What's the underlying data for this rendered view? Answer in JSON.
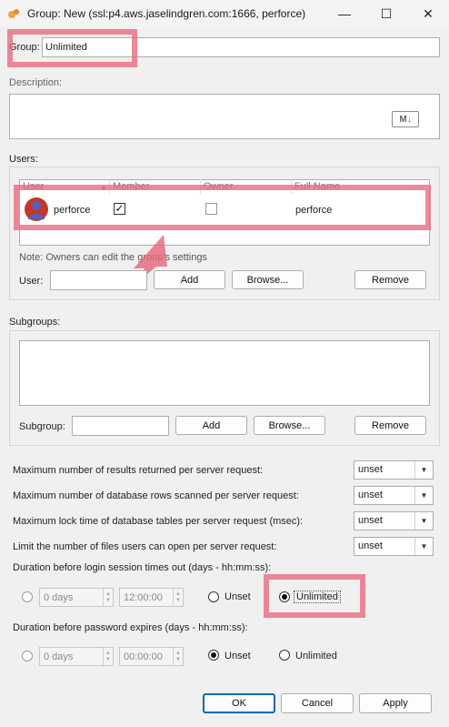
{
  "window": {
    "title": "Group: New (ssl:p4.aws.jaselindgren.com:1666,  perforce)",
    "minimize": "—",
    "maximize": "☐",
    "close": "✕"
  },
  "group": {
    "label": "Group:",
    "value": "Unlimited"
  },
  "description": {
    "label": "Description:",
    "badge": "M↓"
  },
  "users": {
    "label": "Users:",
    "columns": [
      "User",
      "Member",
      "Owner",
      "Full Name"
    ],
    "sort_indicator": "▲",
    "rows": [
      {
        "user": "perforce",
        "member": "✓",
        "owner": "",
        "full_name": "perforce"
      }
    ],
    "note": "Note: Owners can edit the group's settings",
    "user_label": "User:",
    "user_value": "",
    "add": "Add",
    "browse": "Browse...",
    "remove": "Remove"
  },
  "subgroups": {
    "label": "Subgroups:",
    "subgroup_label": "Subgroup:",
    "subgroup_value": "",
    "add": "Add",
    "browse": "Browse...",
    "remove": "Remove"
  },
  "limits": [
    {
      "label": "Maximum number of results returned per server request:",
      "value": "unset"
    },
    {
      "label": "Maximum number of database rows scanned per server request:",
      "value": "unset"
    },
    {
      "label": "Maximum lock time of database tables per server request (msec):",
      "value": "unset"
    },
    {
      "label": "Limit the number of files users can open per server request:",
      "value": "unset"
    }
  ],
  "session": {
    "label": "Duration before login session times out (days - hh:mm:ss):",
    "days": "0 days",
    "time": "12:00:00",
    "unset": "Unset",
    "unlimited": "Unlimited",
    "selected": "unlimited"
  },
  "password": {
    "label": "Duration before password expires (days - hh:mm:ss):",
    "days": "0 days",
    "time": "00:00:00",
    "unset": "Unset",
    "unlimited": "Unlimited",
    "selected": "unset"
  },
  "footer": {
    "ok": "OK",
    "cancel": "Cancel",
    "apply": "Apply"
  },
  "colors": {
    "highlight": "#e8687c",
    "accent": "#0067c0"
  }
}
